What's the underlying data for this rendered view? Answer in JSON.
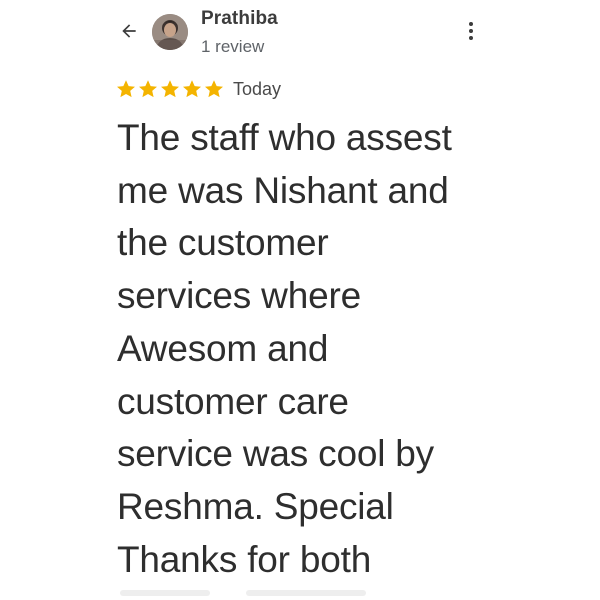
{
  "header": {
    "back_icon": "arrow-left-icon",
    "reviewer_name": "Prathiba",
    "review_count": "1 review",
    "more_icon": "more-vert-icon"
  },
  "rating": {
    "stars": 5,
    "max_stars": 5,
    "star_color": "#f4b400",
    "date": "Today"
  },
  "review": {
    "text": "The staff who assest\nme was Nishant and\nthe customer\nservices where\nAwesom and\ncustomer care\nservice was cool by\nReshma. Special\nThanks for both"
  }
}
